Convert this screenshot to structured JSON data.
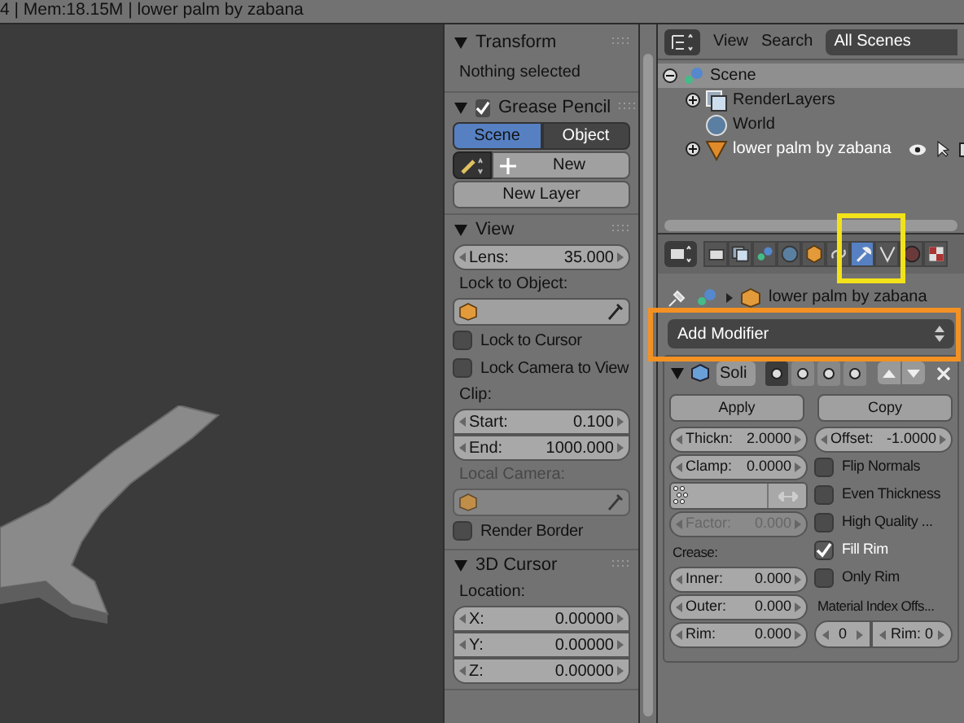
{
  "status_bar": {
    "text": "4 | Mem:18.15M | lower palm by zabana"
  },
  "n_panel": {
    "panels": [
      {
        "title": "Transform",
        "expanded": true,
        "items": [
          {
            "kind": "text",
            "text": "Nothing selected"
          }
        ]
      },
      {
        "title": "Grease Pencil",
        "expanded": true,
        "checked": true,
        "items": [
          {
            "kind": "segmented",
            "options": [
              {
                "label": "Scene",
                "selected": true
              },
              {
                "label": "Object",
                "selected": false
              }
            ]
          },
          {
            "kind": "new_row",
            "label": "New"
          },
          {
            "kind": "button",
            "label": "New Layer"
          }
        ]
      },
      {
        "title": "View",
        "expanded": true,
        "items": [
          {
            "kind": "numbers",
            "fields": [
              {
                "label": "Lens:",
                "value": "35.000"
              }
            ]
          },
          {
            "kind": "label",
            "text": "Lock to Object:",
            "disabled": false
          },
          {
            "kind": "object_field",
            "disabled": false
          },
          {
            "kind": "checkbox",
            "label": "Lock to Cursor",
            "checked": false
          },
          {
            "kind": "checkbox",
            "label": "Lock Camera to View",
            "checked": false
          },
          {
            "kind": "label",
            "text": "Clip:",
            "disabled": false
          },
          {
            "kind": "numbers",
            "fields": [
              {
                "label": "Start:",
                "value": "0.100"
              },
              {
                "label": "End:",
                "value": "1000.000"
              }
            ]
          },
          {
            "kind": "label",
            "text": "Local Camera:",
            "disabled": true
          },
          {
            "kind": "object_field",
            "disabled": true
          },
          {
            "kind": "checkbox",
            "label": "Render Border",
            "checked": false
          }
        ]
      },
      {
        "title": "3D Cursor",
        "expanded": true,
        "items": [
          {
            "kind": "label",
            "text": "Location:",
            "disabled": false
          },
          {
            "kind": "numbers",
            "fields": [
              {
                "label": "X:",
                "value": "0.00000"
              },
              {
                "label": "Y:",
                "value": "0.00000"
              },
              {
                "label": "Z:",
                "value": "0.00000"
              }
            ]
          }
        ]
      }
    ]
  },
  "outliner": {
    "menus": [
      "View",
      "Search"
    ],
    "scene_select": "All Scenes",
    "tree": [
      {
        "label": "Scene",
        "expanded": true,
        "selected": true,
        "children": [
          {
            "label": "RenderLayers",
            "expanded": false,
            "selected": false
          },
          {
            "label": "World",
            "selected": false
          },
          {
            "label": "lower palm by zabana",
            "expanded": false,
            "selected": false
          }
        ]
      }
    ]
  },
  "properties": {
    "tabs": [
      {
        "selected": false
      },
      {
        "selected": false
      },
      {
        "selected": false
      },
      {
        "selected": false
      },
      {
        "selected": false
      },
      {
        "selected": false
      },
      {
        "selected": true
      },
      {
        "selected": false
      },
      {
        "selected": false
      },
      {
        "selected": false
      }
    ],
    "breadcrumb": "lower palm by zabana",
    "add_modifier": "Add Modifier",
    "modifier": {
      "name": "Soli",
      "expanded": true,
      "buttons": [
        "Apply",
        "Copy"
      ],
      "left": [
        {
          "kind": "number",
          "label": "Thickn:",
          "value": "2.0000",
          "disabled": false
        },
        {
          "kind": "number",
          "label": "Clamp:",
          "value": "0.0000",
          "disabled": false
        },
        {
          "kind": "group_field"
        },
        {
          "kind": "number",
          "label": "Factor:",
          "value": "0.000",
          "disabled": true
        },
        {
          "kind": "label",
          "text": "Crease:"
        },
        {
          "kind": "number",
          "label": "Inner:",
          "value": "0.000",
          "disabled": false
        },
        {
          "kind": "number",
          "label": "Outer:",
          "value": "0.000",
          "disabled": false
        },
        {
          "kind": "number",
          "label": "Rim:",
          "value": "0.000",
          "disabled": false
        }
      ],
      "right": [
        {
          "kind": "number",
          "label": "Offset:",
          "value": "-1.0000",
          "disabled": false
        },
        {
          "kind": "checkbox",
          "label": "Flip Normals",
          "checked": false
        },
        {
          "kind": "checkbox",
          "label": "Even Thickness",
          "checked": false
        },
        {
          "kind": "checkbox",
          "label": "High Quality ...",
          "checked": false
        },
        {
          "kind": "checkbox",
          "label": "Fill Rim",
          "checked": true
        },
        {
          "kind": "checkbox",
          "label": "Only Rim",
          "checked": false
        },
        {
          "kind": "label",
          "text": "Material Index Offs..."
        },
        {
          "kind": "pair",
          "values": [
            "0",
            "Rim: 0"
          ]
        }
      ]
    }
  }
}
